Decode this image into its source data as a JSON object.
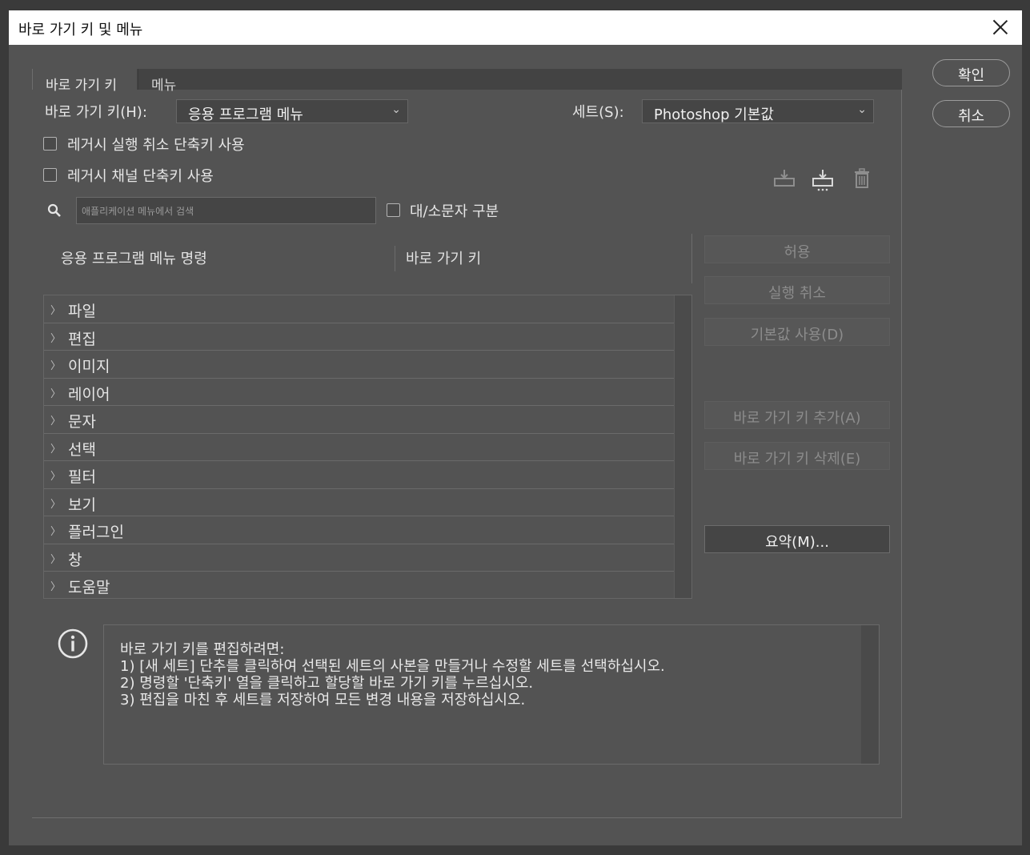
{
  "window": {
    "title": "바로 가기 키 및 메뉴"
  },
  "tabs": [
    {
      "label": "바로 가기 키",
      "active": true
    },
    {
      "label": "메뉴",
      "active": false
    }
  ],
  "shortcuts_for": {
    "label": "바로 가기 키(H):",
    "value": "응용 프로그램 메뉴"
  },
  "set": {
    "label": "세트(S):",
    "value": "Photoshop 기본값"
  },
  "options": {
    "legacy_undo": {
      "label": "레거시 실행 취소 단축키 사용",
      "checked": false
    },
    "legacy_channel": {
      "label": "레거시 채널 단축키 사용",
      "checked": false
    }
  },
  "search": {
    "placeholder": "애플리케이션 메뉴에서 검색",
    "value": ""
  },
  "case_sensitive": {
    "label": "대/소문자 구분",
    "checked": false
  },
  "columns": {
    "command": "응용 프로그램 메뉴 명령",
    "shortcut": "바로 가기 키"
  },
  "menu_items": [
    {
      "label": "파일"
    },
    {
      "label": "편집"
    },
    {
      "label": "이미지"
    },
    {
      "label": "레이어"
    },
    {
      "label": "문자"
    },
    {
      "label": "선택"
    },
    {
      "label": "필터"
    },
    {
      "label": "보기"
    },
    {
      "label": "플러그인"
    },
    {
      "label": "창"
    },
    {
      "label": "도움말"
    }
  ],
  "side_buttons": {
    "accept": "허용",
    "undo": "실행 취소",
    "use_default": "기본값 사용(D)",
    "add_shortcut": "바로 가기 키 추가(A)",
    "delete_shortcut": "바로 가기 키 삭제(E)",
    "summarize": "요약(M)..."
  },
  "dialog_buttons": {
    "ok": "확인",
    "cancel": "취소"
  },
  "info": {
    "lines": [
      "바로 가기 키를 편집하려면:",
      "1) [새 세트] 단추를 클릭하여 선택된 세트의 사본을 만들거나 수정할 세트를 선택하십시오.",
      "2) 명령할 '단축키' 열을 클릭하고 할당할 바로 가기 키를 누르십시오.",
      "3) 편집을 마친 후 세트를 저장하여 모든 변경 내용을 저장하십시오."
    ]
  },
  "icons": {
    "save_set": "save-set-icon",
    "save_set_as": "save-set-as-icon",
    "delete_set": "trash-icon",
    "search": "search-icon",
    "info": "info-icon"
  },
  "colors": {
    "background": "#535353",
    "titlebar": "#ffffff",
    "disabled_text": "#8c8c8c"
  }
}
